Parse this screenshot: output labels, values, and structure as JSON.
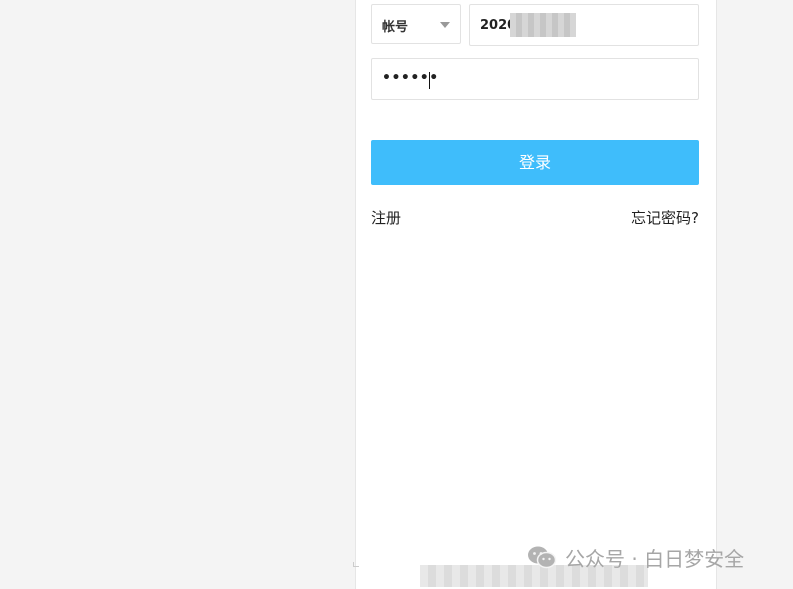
{
  "login": {
    "account_type": "帐号",
    "account_value": "2020",
    "password_value": "••••••",
    "login_label": "登录",
    "register_label": "注册",
    "forgot_label": "忘记密码?"
  },
  "watermark": {
    "text": "公众号 · 白日梦安全",
    "icon": "wechat-icon"
  },
  "colors": {
    "primary_button": "#3fbdfb",
    "page_background": "#f4f4f4",
    "panel_background": "#ffffff",
    "watermark": "#a6a6a6"
  }
}
